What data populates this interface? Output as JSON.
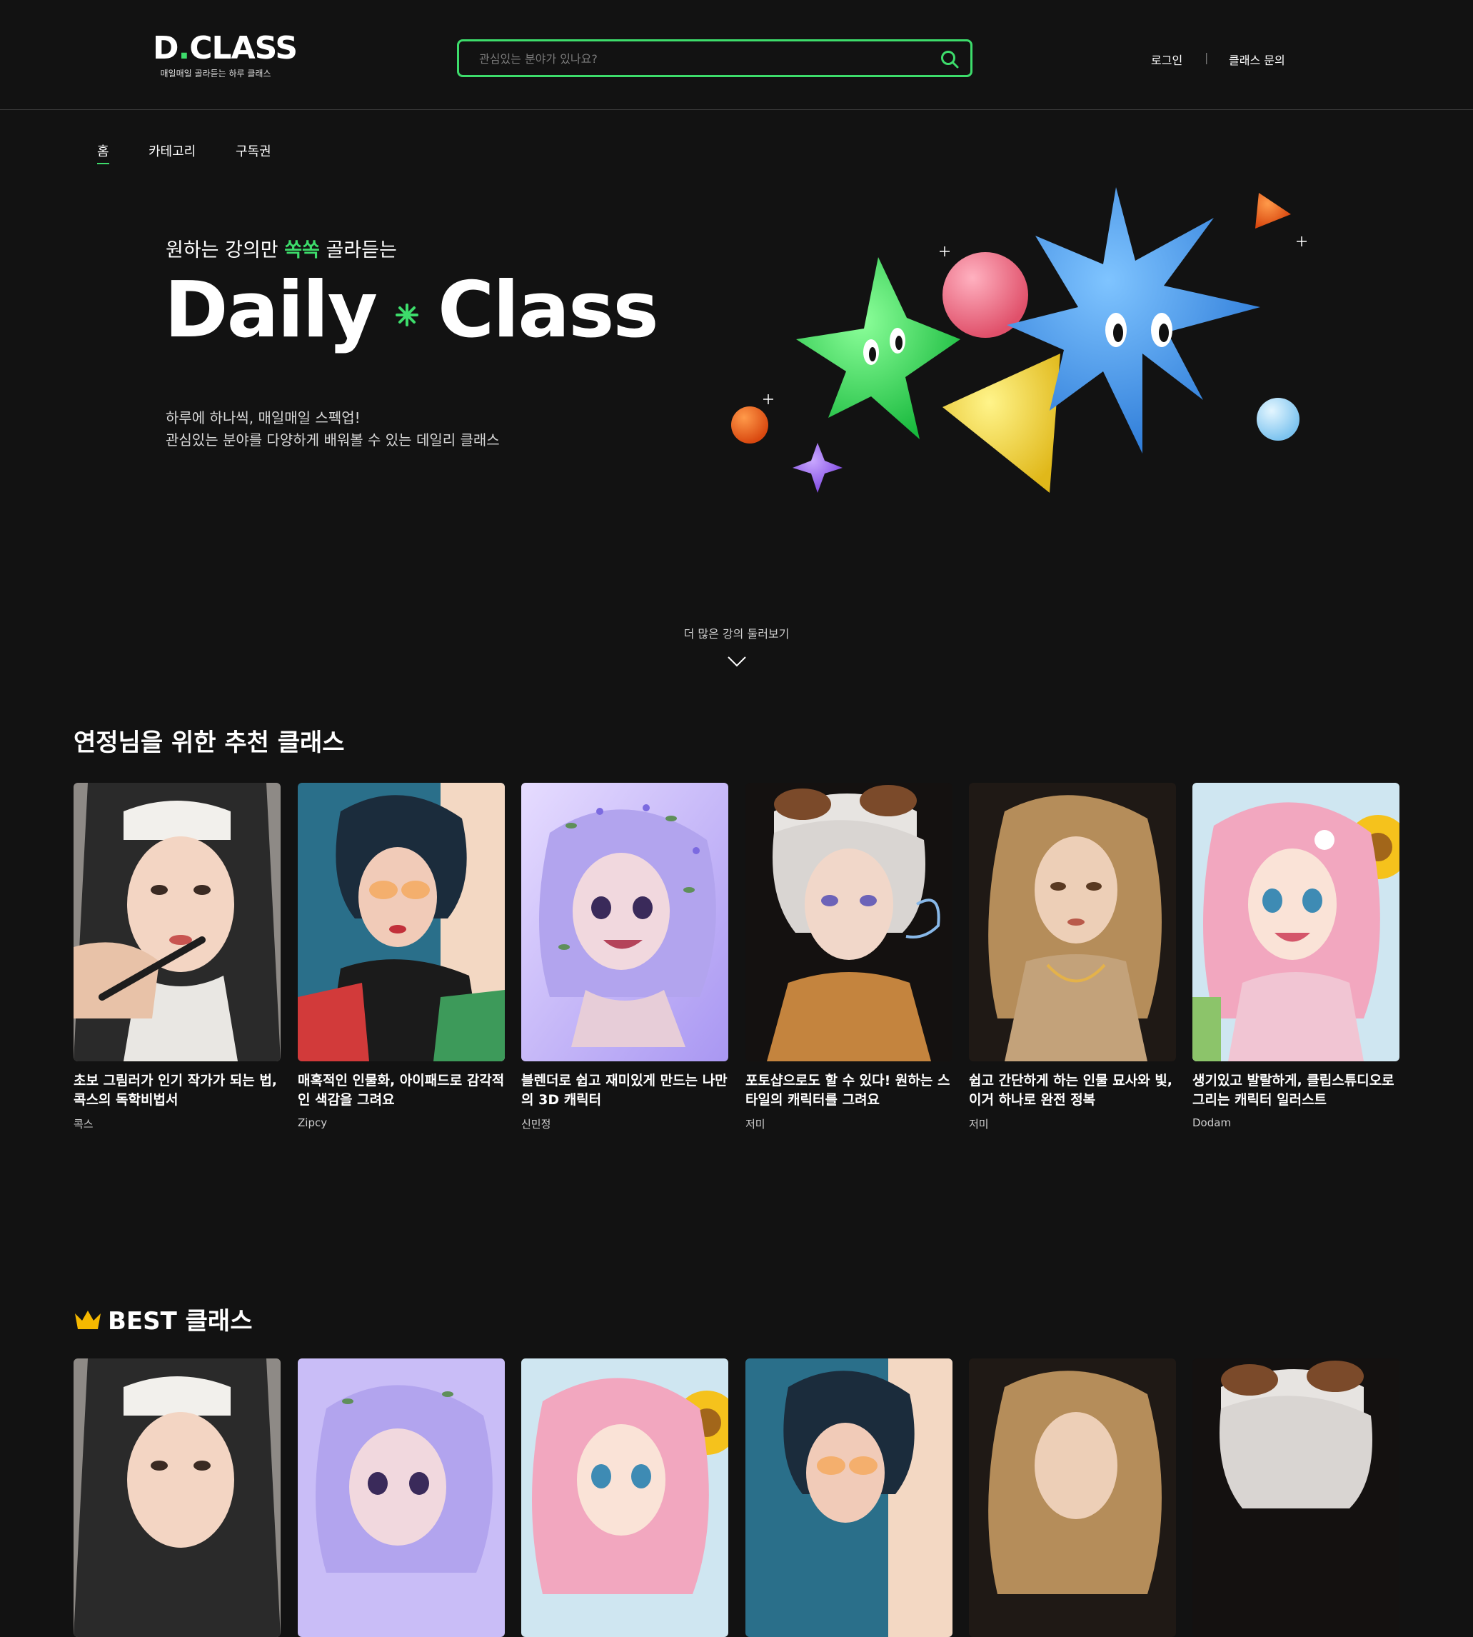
{
  "header": {
    "logo_main_left": "D",
    "logo_main_right": "CLASS",
    "logo_sub": "매일매일 골라듣는 하루 클래스",
    "search_placeholder": "관심있는 분야가 있나요?",
    "login": "로그인",
    "separator": "|",
    "inquiry": "클래스 문의"
  },
  "nav": {
    "items": [
      {
        "label": "홈",
        "active": true
      },
      {
        "label": "카테고리"
      },
      {
        "label": "구독권"
      }
    ]
  },
  "hero": {
    "subtitle_before": "원하는 강의만 ",
    "subtitle_accent": "쏙쏙",
    "subtitle_after": " 골라듣는",
    "title_left": "Daily",
    "title_right": "Class",
    "desc_line1": "하루에 하나씩, 매일매일 스펙업!",
    "desc_line2": "관심있는 분야를 다양하게 배워볼 수 있는 데일리 클래스"
  },
  "more_label": "더 많은 강의 둘러보기",
  "recommend": {
    "title": "연정님을 위한 추천 클래스",
    "cards": [
      {
        "title": "초보 그림러가 인기 작가가 되는 법, 콕스의 독학비법서",
        "author": "콕스"
      },
      {
        "title": "매혹적인 인물화, 아이패드로 감각적인 색감을 그려요",
        "author": "Zipcy"
      },
      {
        "title": "블렌더로 쉽고 재미있게 만드는 나만의 3D 캐릭터",
        "author": "신민정"
      },
      {
        "title": "포토샵으로도 할 수 있다! 원하는 스타일의 캐릭터를 그려요",
        "author": "저미"
      },
      {
        "title": "쉽고 간단하게 하는 인물 묘사와 빛, 이거 하나로 완전 정복",
        "author": "저미"
      },
      {
        "title": "생기있고 발랄하게, 클립스튜디오로 그리는 캐릭터 일러스트",
        "author": "Dodam"
      }
    ]
  },
  "best": {
    "title": "BEST 클래스"
  },
  "colors": {
    "background": "#121212",
    "accent": "#3ddc6b",
    "crown": "#f5b800"
  }
}
